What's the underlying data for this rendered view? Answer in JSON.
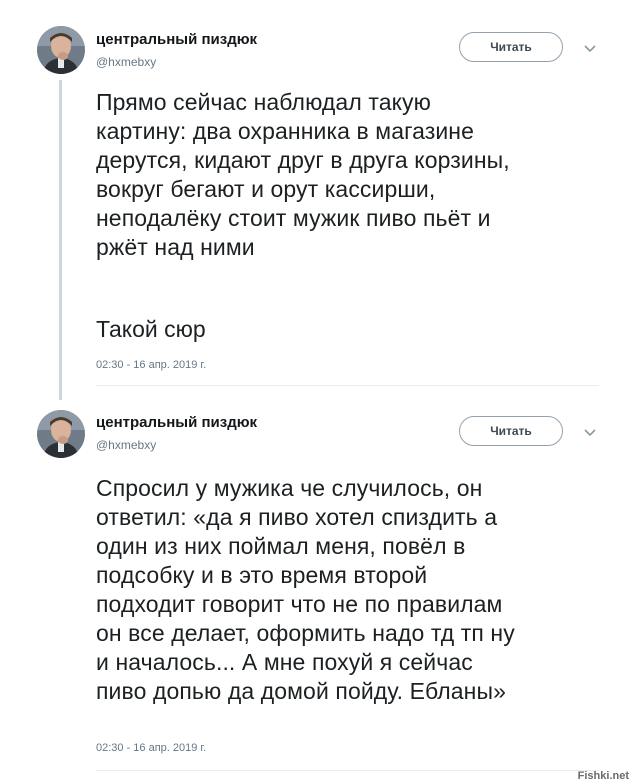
{
  "tweets": [
    {
      "author_name": "центральный пиздюк",
      "author_handle": "@hxmebxy",
      "follow_label": "Читать",
      "text_lines": [
        "Прямо сейчас наблюдал такую",
        "картину: два охранника в магазине",
        "дерутся, кидают друг в друга корзины,",
        "вокруг бегают и орут кассирши,",
        "неподалёку стоит мужик пиво пьёт и",
        "ржёт над ними"
      ],
      "text_extra": "Такой сюр",
      "timestamp": "02:30 - 16 апр. 2019 г."
    },
    {
      "author_name": "центральный пиздюк",
      "author_handle": "@hxmebxy",
      "follow_label": "Читать",
      "text_lines": [
        "Спросил у мужика че случилось, он",
        "ответил: «да я пиво хотел спиздить а",
        "один из них поймал меня, повёл в",
        "подсобку и в это время второй",
        "подходит говорит что не по правилам",
        "он все делает, оформить надо тд тп ну",
        "и началось... А мне похуй я сейчас",
        "пиво допью да домой пойду. Ебланы»"
      ],
      "timestamp": "02:30 - 16 апр. 2019 г."
    }
  ],
  "watermark": "Fishki.net",
  "icons": {
    "menu": "chevron-down-icon",
    "avatar": "avatar-photo"
  },
  "colors": {
    "secondary_text": "#657786",
    "divider": "#e6ecf0",
    "thread_line": "#ccd6dd"
  }
}
